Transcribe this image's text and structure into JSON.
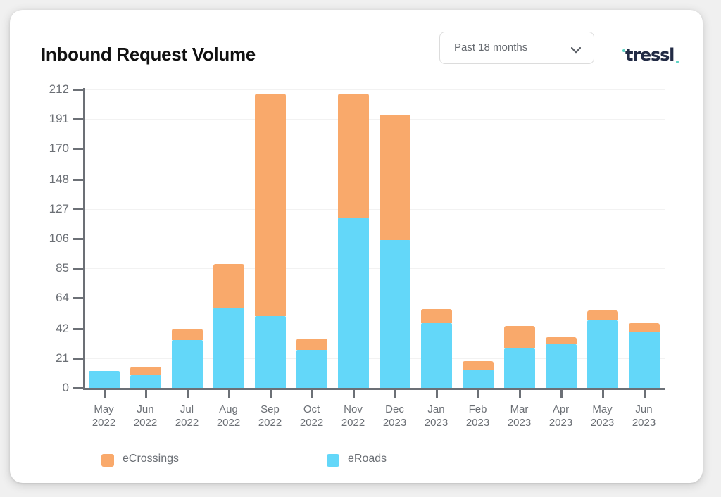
{
  "header": {
    "title": "Inbound Request Volume",
    "range_select": {
      "value": "Past 18 months",
      "icon": "chevron-down-icon"
    },
    "brand": {
      "name": "tressl",
      "dot_color": "#5fd3c4",
      "text_color": "#222b45"
    }
  },
  "legend": [
    {
      "label": "eCrossings",
      "color": "#f9a96b"
    },
    {
      "label": "eRoads",
      "color": "#63d7f9"
    }
  ],
  "chart_data": {
    "type": "bar",
    "stacked": true,
    "title": "Inbound Request Volume",
    "xlabel": "",
    "ylabel": "",
    "grid": true,
    "legend_position": "bottom-left",
    "ylim": [
      0,
      212
    ],
    "yticks": [
      0,
      21,
      42,
      64,
      85,
      106,
      127,
      148,
      170,
      191,
      212
    ],
    "ytick_labels": [
      "0",
      "21",
      "42",
      "64",
      "85",
      "106",
      "127",
      "148",
      "170",
      "191",
      "212"
    ],
    "categories": [
      "May\n2022",
      "Jun\n2022",
      "Jul\n2022",
      "Aug\n2022",
      "Sep\n2022",
      "Oct\n2022",
      "Nov\n2022",
      "Dec\n2023",
      "Jan\n2023",
      "Feb\n2023",
      "Mar\n2023",
      "Apr\n2023",
      "May\n2023",
      "Jun\n2023"
    ],
    "category_labels": [
      {
        "month": "May",
        "year": "2022"
      },
      {
        "month": "Jun",
        "year": "2022"
      },
      {
        "month": "Jul",
        "year": "2022"
      },
      {
        "month": "Aug",
        "year": "2022"
      },
      {
        "month": "Sep",
        "year": "2022"
      },
      {
        "month": "Oct",
        "year": "2022"
      },
      {
        "month": "Nov",
        "year": "2022"
      },
      {
        "month": "Dec",
        "year": "2023"
      },
      {
        "month": "Jan",
        "year": "2023"
      },
      {
        "month": "Feb",
        "year": "2023"
      },
      {
        "month": "Mar",
        "year": "2023"
      },
      {
        "month": "Apr",
        "year": "2023"
      },
      {
        "month": "May",
        "year": "2023"
      },
      {
        "month": "Jun",
        "year": "2023"
      }
    ],
    "series": [
      {
        "name": "eRoads",
        "color": "#63d7f9",
        "values": [
          12,
          9,
          34,
          57,
          51,
          27,
          121,
          105,
          46,
          13,
          28,
          31,
          48,
          40
        ]
      },
      {
        "name": "eCrossings",
        "color": "#f9a96b",
        "values": [
          0,
          6,
          8,
          31,
          158,
          8,
          88,
          89,
          10,
          6,
          16,
          5,
          7,
          6
        ]
      }
    ],
    "totals": [
      12,
      15,
      42,
      88,
      209,
      35,
      209,
      194,
      56,
      19,
      44,
      36,
      55,
      46
    ]
  }
}
